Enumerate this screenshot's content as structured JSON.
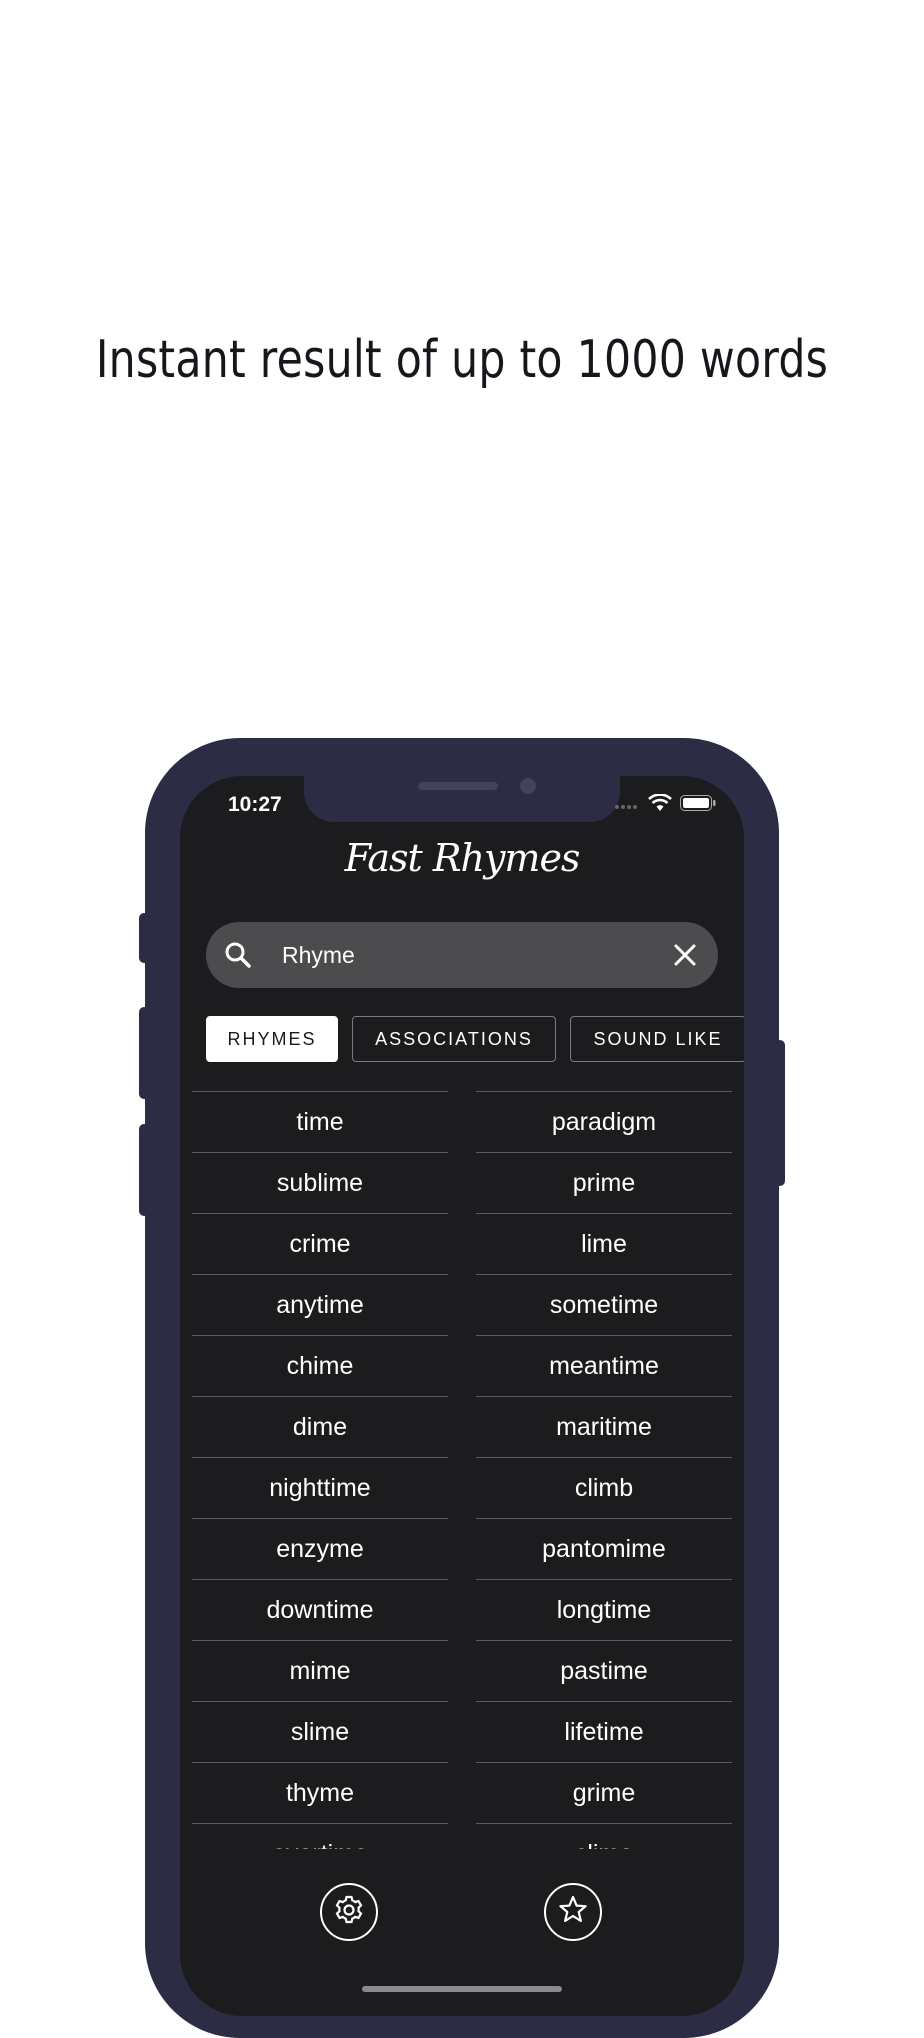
{
  "headline": "Instant result of up to 1000 words",
  "status_bar": {
    "time": "10:27"
  },
  "app": {
    "logo_text": "Fast Rhymes"
  },
  "search": {
    "value": "Rhyme",
    "placeholder": ""
  },
  "tabs": [
    {
      "label": "RHYMES",
      "active": true
    },
    {
      "label": "ASSOCIATIONS",
      "active": false
    },
    {
      "label": "SOUND LIKE",
      "active": false
    }
  ],
  "results": {
    "left": [
      "time",
      "sublime",
      "crime",
      "anytime",
      "chime",
      "dime",
      "nighttime",
      "enzyme",
      "downtime",
      "mime",
      "slime",
      "thyme",
      "overtime"
    ],
    "right": [
      "paradigm",
      "prime",
      "lime",
      "sometime",
      "meantime",
      "maritime",
      "climb",
      "pantomime",
      "longtime",
      "pastime",
      "lifetime",
      "grime",
      "clime"
    ]
  },
  "bottom_nav": {
    "left_icon": "gear-icon",
    "right_icon": "star-icon"
  },
  "colors": {
    "frame": "#2c2d44",
    "screen": "#1c1c1e",
    "search_bg": "#4c4c4f",
    "accent": "#ffffff"
  }
}
